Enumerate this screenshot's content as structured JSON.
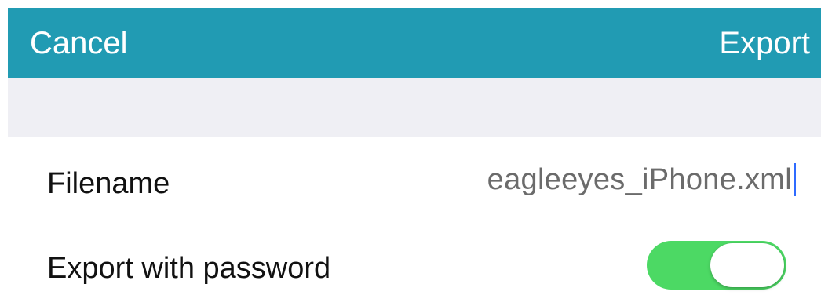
{
  "navbar": {
    "cancel_label": "Cancel",
    "export_label": "Export",
    "background_color": "#219bb3"
  },
  "form": {
    "filename": {
      "label": "Filename",
      "value": "eagleeyes_iPhone.xml"
    },
    "export_with_password": {
      "label": "Export with password",
      "enabled": true,
      "toggle_color": "#4cd964"
    }
  }
}
